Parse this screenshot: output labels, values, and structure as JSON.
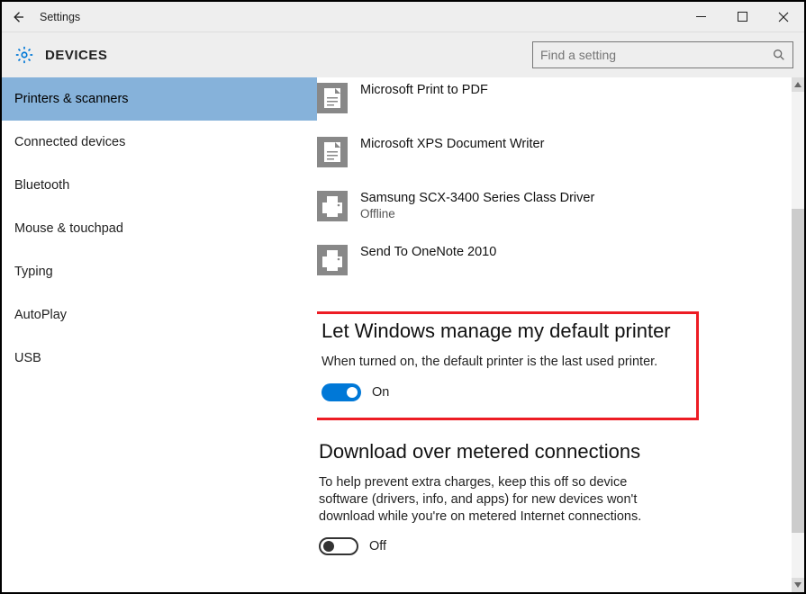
{
  "titlebar": {
    "title": "Settings"
  },
  "header": {
    "section": "DEVICES"
  },
  "search": {
    "placeholder": "Find a setting"
  },
  "sidebar": {
    "items": [
      {
        "label": "Printers & scanners",
        "selected": true
      },
      {
        "label": "Connected devices",
        "selected": false
      },
      {
        "label": "Bluetooth",
        "selected": false
      },
      {
        "label": "Mouse & touchpad",
        "selected": false
      },
      {
        "label": "Typing",
        "selected": false
      },
      {
        "label": "AutoPlay",
        "selected": false
      },
      {
        "label": "USB",
        "selected": false
      }
    ]
  },
  "printers": [
    {
      "name": "Microsoft Print to PDF",
      "status": null,
      "icon": "doc"
    },
    {
      "name": "Microsoft XPS Document Writer",
      "status": null,
      "icon": "doc"
    },
    {
      "name": "Samsung SCX-3400 Series Class Driver",
      "status": "Offline",
      "icon": "printer"
    },
    {
      "name": "Send To OneNote 2010",
      "status": null,
      "icon": "printer"
    }
  ],
  "manage_default": {
    "title": "Let Windows manage my default printer",
    "desc": "When turned on, the default printer is the last used printer.",
    "state_label": "On",
    "on": true
  },
  "metered": {
    "title": "Download over metered connections",
    "desc": "To help prevent extra charges, keep this off so device software (drivers, info, and apps) for new devices won't download while you're on metered Internet connections.",
    "state_label": "Off",
    "on": false
  }
}
